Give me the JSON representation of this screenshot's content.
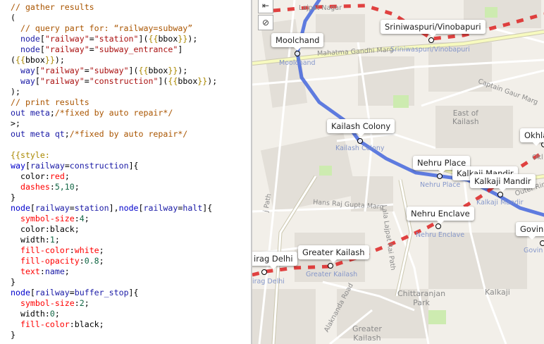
{
  "editor": {
    "colors": {
      "plain": "#000000",
      "comment": "#aa5500",
      "keyword": "#1a1aa6",
      "string": "#aa1111",
      "brace": "#aa8800",
      "property": "#ff0000",
      "tag": "#0000cc",
      "number": "#116644"
    },
    "lines": [
      [
        {
          "t": "// gather results",
          "c": "comment"
        }
      ],
      [
        {
          "t": "(",
          "c": "plain"
        }
      ],
      [
        {
          "t": "  // query part for: “railway=subway”",
          "c": "comment"
        }
      ],
      [
        {
          "t": "  node",
          "c": "keyword"
        },
        {
          "t": "[",
          "c": "plain"
        },
        {
          "t": "\"railway\"",
          "c": "string"
        },
        {
          "t": "=",
          "c": "plain"
        },
        {
          "t": "\"station\"",
          "c": "string"
        },
        {
          "t": "](",
          "c": "plain"
        },
        {
          "t": "{{",
          "c": "brace"
        },
        {
          "t": "bbox",
          "c": "plain"
        },
        {
          "t": "}}",
          "c": "brace"
        },
        {
          "t": ");",
          "c": "plain"
        }
      ],
      [
        {
          "t": "  node",
          "c": "keyword"
        },
        {
          "t": "[",
          "c": "plain"
        },
        {
          "t": "\"railway\"",
          "c": "string"
        },
        {
          "t": "=",
          "c": "plain"
        },
        {
          "t": "\"subway_entrance\"",
          "c": "string"
        },
        {
          "t": "]",
          "c": "plain"
        }
      ],
      [
        {
          "t": "(",
          "c": "plain"
        },
        {
          "t": "{{",
          "c": "brace"
        },
        {
          "t": "bbox",
          "c": "plain"
        },
        {
          "t": "}}",
          "c": "brace"
        },
        {
          "t": ");",
          "c": "plain"
        }
      ],
      [
        {
          "t": "  way",
          "c": "keyword"
        },
        {
          "t": "[",
          "c": "plain"
        },
        {
          "t": "\"railway\"",
          "c": "string"
        },
        {
          "t": "=",
          "c": "plain"
        },
        {
          "t": "\"subway\"",
          "c": "string"
        },
        {
          "t": "](",
          "c": "plain"
        },
        {
          "t": "{{",
          "c": "brace"
        },
        {
          "t": "bbox",
          "c": "plain"
        },
        {
          "t": "}}",
          "c": "brace"
        },
        {
          "t": ");",
          "c": "plain"
        }
      ],
      [
        {
          "t": "  way",
          "c": "keyword"
        },
        {
          "t": "[",
          "c": "plain"
        },
        {
          "t": "\"railway\"",
          "c": "string"
        },
        {
          "t": "=",
          "c": "plain"
        },
        {
          "t": "\"construction\"",
          "c": "string"
        },
        {
          "t": "](",
          "c": "plain"
        },
        {
          "t": "{{",
          "c": "brace"
        },
        {
          "t": "bbox",
          "c": "plain"
        },
        {
          "t": "}}",
          "c": "brace"
        },
        {
          "t": ");",
          "c": "plain"
        }
      ],
      [
        {
          "t": ");",
          "c": "plain"
        }
      ],
      [
        {
          "t": "// print results",
          "c": "comment"
        }
      ],
      [
        {
          "t": "out meta",
          "c": "keyword"
        },
        {
          "t": ";",
          "c": "plain"
        },
        {
          "t": "/*fixed by auto repair*/",
          "c": "comment"
        }
      ],
      [
        {
          "t": ">;",
          "c": "plain"
        }
      ],
      [
        {
          "t": "out meta qt",
          "c": "keyword"
        },
        {
          "t": ";",
          "c": "plain"
        },
        {
          "t": "/*fixed by auto repair*/",
          "c": "comment"
        }
      ],
      [
        {
          "t": "",
          "c": "plain"
        }
      ],
      [
        {
          "t": "{{style:",
          "c": "brace"
        }
      ],
      [
        {
          "t": "way",
          "c": "tag"
        },
        {
          "t": "[",
          "c": "plain"
        },
        {
          "t": "railway",
          "c": "keyword"
        },
        {
          "t": "=",
          "c": "plain"
        },
        {
          "t": "construction",
          "c": "keyword"
        },
        {
          "t": "]{",
          "c": "plain"
        }
      ],
      [
        {
          "t": "  color",
          "c": "plain"
        },
        {
          "t": ":",
          "c": "plain"
        },
        {
          "t": "red",
          "c": "property"
        },
        {
          "t": ";",
          "c": "plain"
        }
      ],
      [
        {
          "t": "  dashes",
          "c": "property"
        },
        {
          "t": ":",
          "c": "plain"
        },
        {
          "t": "5,10",
          "c": "number"
        },
        {
          "t": ";",
          "c": "plain"
        }
      ],
      [
        {
          "t": "}",
          "c": "plain"
        }
      ],
      [
        {
          "t": "node",
          "c": "tag"
        },
        {
          "t": "[",
          "c": "plain"
        },
        {
          "t": "railway",
          "c": "keyword"
        },
        {
          "t": "=",
          "c": "plain"
        },
        {
          "t": "station",
          "c": "keyword"
        },
        {
          "t": "],",
          "c": "plain"
        },
        {
          "t": "node",
          "c": "tag"
        },
        {
          "t": "[",
          "c": "plain"
        },
        {
          "t": "railway",
          "c": "keyword"
        },
        {
          "t": "=",
          "c": "plain"
        },
        {
          "t": "halt",
          "c": "keyword"
        },
        {
          "t": "]{",
          "c": "plain"
        }
      ],
      [
        {
          "t": "  symbol-size",
          "c": "property"
        },
        {
          "t": ":",
          "c": "plain"
        },
        {
          "t": "4",
          "c": "number"
        },
        {
          "t": ";",
          "c": "plain"
        }
      ],
      [
        {
          "t": "  color",
          "c": "plain"
        },
        {
          "t": ":",
          "c": "plain"
        },
        {
          "t": "black",
          "c": "plain"
        },
        {
          "t": ";",
          "c": "plain"
        }
      ],
      [
        {
          "t": "  width",
          "c": "plain"
        },
        {
          "t": ":",
          "c": "plain"
        },
        {
          "t": "1",
          "c": "number"
        },
        {
          "t": ";",
          "c": "plain"
        }
      ],
      [
        {
          "t": "  fill-color",
          "c": "property"
        },
        {
          "t": ":",
          "c": "plain"
        },
        {
          "t": "white",
          "c": "property"
        },
        {
          "t": ";",
          "c": "plain"
        }
      ],
      [
        {
          "t": "  fill-opacity",
          "c": "property"
        },
        {
          "t": ":",
          "c": "plain"
        },
        {
          "t": "0.8",
          "c": "number"
        },
        {
          "t": ";",
          "c": "plain"
        }
      ],
      [
        {
          "t": "  text",
          "c": "property"
        },
        {
          "t": ":",
          "c": "plain"
        },
        {
          "t": "name",
          "c": "keyword"
        },
        {
          "t": ";",
          "c": "plain"
        }
      ],
      [
        {
          "t": "}",
          "c": "plain"
        }
      ],
      [
        {
          "t": "node",
          "c": "tag"
        },
        {
          "t": "[",
          "c": "plain"
        },
        {
          "t": "railway",
          "c": "keyword"
        },
        {
          "t": "=",
          "c": "plain"
        },
        {
          "t": "buffer_stop",
          "c": "keyword"
        },
        {
          "t": "]{",
          "c": "plain"
        }
      ],
      [
        {
          "t": "  symbol-size",
          "c": "property"
        },
        {
          "t": ":",
          "c": "plain"
        },
        {
          "t": "2",
          "c": "number"
        },
        {
          "t": ";",
          "c": "plain"
        }
      ],
      [
        {
          "t": "  width",
          "c": "plain"
        },
        {
          "t": ":",
          "c": "plain"
        },
        {
          "t": "0",
          "c": "number"
        },
        {
          "t": ";",
          "c": "plain"
        }
      ],
      [
        {
          "t": "  fill-color",
          "c": "property"
        },
        {
          "t": ":",
          "c": "plain"
        },
        {
          "t": "black",
          "c": "plain"
        },
        {
          "t": ";",
          "c": "plain"
        }
      ],
      [
        {
          "t": "}",
          "c": "plain"
        }
      ]
    ]
  },
  "map": {
    "controls": {
      "zoom_icon": "collapse-icon",
      "reset_icon": "no-entry-icon",
      "zoom_glyph": "⇤",
      "reset_glyph": "⊘"
    },
    "colors": {
      "subway": "#4466dd",
      "construction": "#dd2222",
      "background": "#f2efe9",
      "road": "#ffffff",
      "major_road": "#f7fabf",
      "park": "#cdebb0"
    },
    "station_labels": [
      {
        "key": "moolchand",
        "name": "Moolchand"
      },
      {
        "key": "sriniwaspuri",
        "name": "Sriniwaspuri/Vinobapuri"
      },
      {
        "key": "kailash_colony",
        "name": "Kailash Colony"
      },
      {
        "key": "nehru_place",
        "name": "Nehru Place"
      },
      {
        "key": "kalkaji_mandir_a",
        "name": "Kalkaji Mandir"
      },
      {
        "key": "kalkaji_mandir_b",
        "name": "Kalkaji Mandir"
      },
      {
        "key": "nehru_enclave",
        "name": "Nehru Enclave"
      },
      {
        "key": "chirag_delhi",
        "name": "irag Delhi"
      },
      {
        "key": "greater_kailash",
        "name": "Greater Kailash"
      },
      {
        "key": "okhla",
        "name": "Okhla"
      },
      {
        "key": "govind",
        "name": "Govin"
      }
    ],
    "station_sublabels": [
      {
        "key": "moolchand",
        "name": "Moolchand"
      },
      {
        "key": "sriniwaspuri",
        "name": "Sriniwaspuri/Vinobapuri"
      },
      {
        "key": "kailash_colony",
        "name": "Kailash Colony"
      },
      {
        "key": "nehru_place",
        "name": "Nehru Place"
      },
      {
        "key": "kalkaji",
        "name": "Kalkaji Mandir"
      },
      {
        "key": "nehru_enclave",
        "name": "Nehru Enclave"
      },
      {
        "key": "chirag_delhi",
        "name": "irag Delhi"
      },
      {
        "key": "greater_kailash",
        "name": "Greater Kailash"
      },
      {
        "key": "govind",
        "name": "Govin"
      }
    ],
    "place_texts": [
      {
        "key": "lajpat_nagar",
        "text": "Lajpat Nagar"
      },
      {
        "key": "mahatma_gandhi_marg",
        "text": "Mahatma Gandhi Marg"
      },
      {
        "key": "captain_gaur_marg",
        "text": "Captain Gaur Marg"
      },
      {
        "key": "east_of_kailash",
        "text": "East of\nKailash"
      },
      {
        "key": "hans_raj_gupta_marg",
        "text": "Hans Raj Gupta Marg"
      },
      {
        "key": "lala_lajpat_rai_path",
        "text": "Lala Lajpat Rai Path"
      },
      {
        "key": "outer_ring",
        "text": "Outer Ring"
      },
      {
        "key": "chittaranjan_park",
        "text": "Chittaranjan\nPark"
      },
      {
        "key": "kalkaji",
        "text": "Kalkaji"
      },
      {
        "key": "greater_kailash_area",
        "text": "Greater\nKailash"
      },
      {
        "key": "alaknanda_road",
        "text": "Alaknanda Road"
      },
      {
        "key": "okhla_short",
        "text": "Okl"
      },
      {
        "key": "raj_path",
        "text": "j Path"
      }
    ]
  }
}
